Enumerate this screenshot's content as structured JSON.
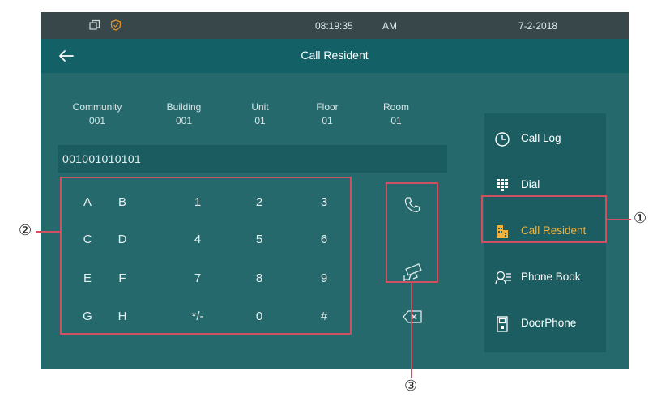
{
  "status_bar": {
    "time": "08:19:35",
    "ampm": "AM",
    "date": "7-2-2018",
    "icons": [
      "window-restore-icon",
      "shield-icon"
    ]
  },
  "title_bar": {
    "back_icon": "back-arrow-icon",
    "title": "Call Resident"
  },
  "address": [
    {
      "label": "Community",
      "value": "001"
    },
    {
      "label": "Building",
      "value": "001"
    },
    {
      "label": "Unit",
      "value": "01"
    },
    {
      "label": "Floor",
      "value": "01"
    },
    {
      "label": "Room",
      "value": "01"
    }
  ],
  "number_field": {
    "value": "001001010101"
  },
  "keypad": {
    "keys": [
      "A",
      "B",
      "1",
      "2",
      "3",
      "C",
      "D",
      "4",
      "5",
      "6",
      "E",
      "F",
      "7",
      "8",
      "9",
      "G",
      "H",
      "*/-",
      "0",
      "#"
    ]
  },
  "actions": {
    "call_icon": "phone-icon",
    "monitor_icon": "camera-icon",
    "backspace_icon": "backspace-icon"
  },
  "menu": {
    "items": [
      {
        "label": "Call Log",
        "icon": "clock-icon",
        "active": false
      },
      {
        "label": "Dial",
        "icon": "keypad-icon",
        "active": false
      },
      {
        "label": "Call Resident",
        "icon": "building-icon",
        "active": true
      },
      {
        "label": "Phone Book",
        "icon": "contacts-icon",
        "active": false
      },
      {
        "label": "DoorPhone",
        "icon": "doorphone-icon",
        "active": false
      }
    ]
  },
  "callouts": {
    "one": "①",
    "two": "②",
    "three": "③"
  },
  "colors": {
    "status_bar": "#37474a",
    "title_bar": "#136066",
    "content_bg": "#26696d",
    "menu_bg": "#1c5d62",
    "active_text": "#f0b23c",
    "callout": "#cf5060"
  }
}
